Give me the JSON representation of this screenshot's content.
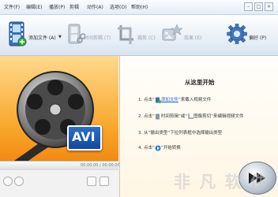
{
  "menu": {
    "file": "文件(F)",
    "edit": "编辑(E)",
    "play": "播放(P)",
    "clip": "剪辑",
    "action": "动作(A)",
    "options": "选项(O)",
    "help": "帮助(H)"
  },
  "toolbar": {
    "add_file": "添加文件 (A)",
    "dropdown_arrow": "▼",
    "trim": "时间剪辑 (T)",
    "crop": "裁剪 (C)",
    "effect": "效果 (E)",
    "preferences": "偏好 (P)"
  },
  "preview": {
    "format_badge": "AVI",
    "time": "00:00:00 / 00:00:00"
  },
  "start": {
    "title": "从这里开始",
    "step1_pre": "1. 点击“",
    "step1_link": "添加文件",
    "step1_post": "”来载入视频文件",
    "step2_pre": "2. 点击“",
    "step2_link": "时间剪辑",
    "step2_mid": "”或“",
    "step2_link2": "图像剪切",
    "step2_post": "”来编辑视频文件",
    "step3": "3. 从“输出类型”下拉列表框中选择输出类型",
    "step4_pre": "4. 点击“",
    "step4_post": "”开始转换"
  },
  "watermark": "非 凡 软 件"
}
